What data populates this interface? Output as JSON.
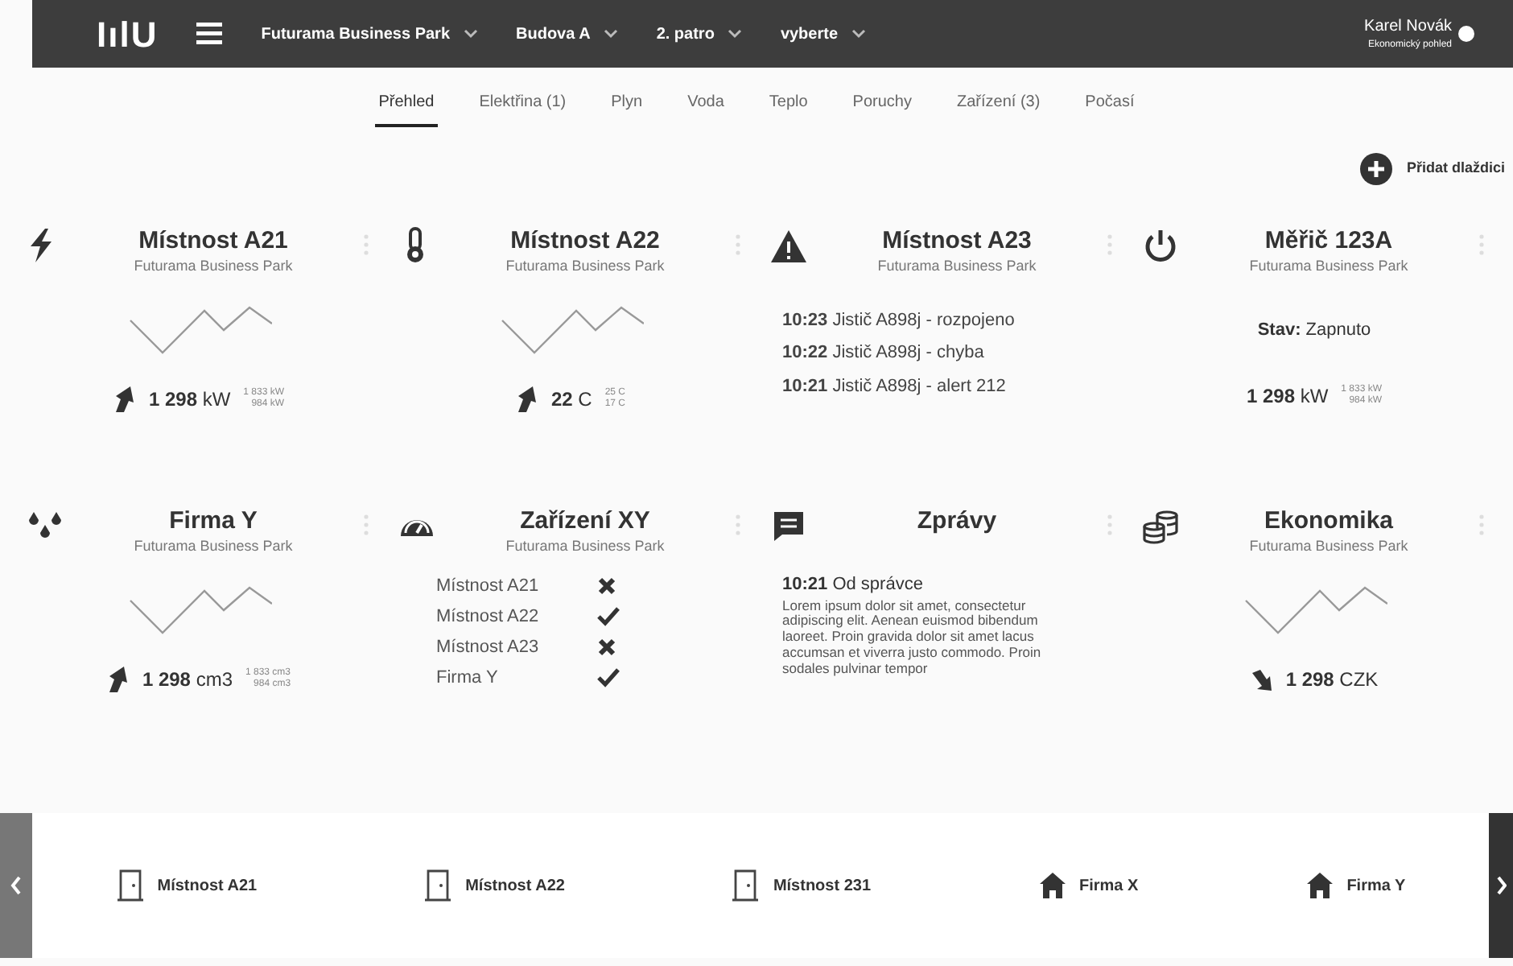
{
  "navbar": {
    "logo": "IılU",
    "breadcrumbs": [
      "Futurama Business Park",
      "Budova A",
      "2. patro",
      "vyberte"
    ],
    "user": {
      "name": "Karel Novák",
      "role": "Ekonomický pohled"
    }
  },
  "tabs": [
    {
      "label": "Přehled",
      "selected": true
    },
    {
      "label": "Elektřina (1)",
      "selected": false
    },
    {
      "label": "Plyn",
      "selected": false
    },
    {
      "label": "Voda",
      "selected": false
    },
    {
      "label": "Teplo",
      "selected": false
    },
    {
      "label": "Poruchy",
      "selected": false
    },
    {
      "label": "Zařízení (3)",
      "selected": false
    },
    {
      "label": "Počasí",
      "selected": false
    }
  ],
  "add_tile": "Přidat dlaždici",
  "tiles": [
    {
      "kind": "metric",
      "title": "Místnost A21",
      "subtitle": "Futurama Business Park",
      "rising": true,
      "value": "1 298",
      "unit": "kW",
      "range": [
        "1 833 kW",
        "984 kW"
      ]
    },
    {
      "kind": "metric",
      "title": "Místnost A22",
      "subtitle": "Futurama Business Park",
      "rising": true,
      "value": "22",
      "unit": "C",
      "range": [
        "25 C",
        "17 C"
      ]
    },
    {
      "kind": "events",
      "title": "Místnost A23",
      "subtitle": "Futurama Business Park",
      "events": [
        {
          "time": "10:23",
          "text": "Jistič A898j - rozpojeno"
        },
        {
          "time": "10:22",
          "text": "Jistič A898j - chyba"
        },
        {
          "time": "10:21",
          "text": "Jistič A898j - alert 212"
        }
      ]
    },
    {
      "kind": "status",
      "title": "Měřič 123A",
      "subtitle": "Futurama Business Park",
      "status_label": "Stav:",
      "status_value": "Zapnuto",
      "value": "1 298",
      "unit": "kW",
      "range": [
        "1 833 kW",
        "984 kW"
      ]
    },
    {
      "kind": "metric",
      "title": "Firma Y",
      "subtitle": "Futurama Business Park",
      "rising": true,
      "value": "1 298",
      "unit": "cm3",
      "range": [
        "1 833 cm3",
        "984 cm3"
      ]
    },
    {
      "kind": "devices",
      "title": "Zařízení XY",
      "subtitle": "Futurama Business Park",
      "devices": [
        {
          "name": "Místnost A21",
          "ok": false
        },
        {
          "name": "Místnost A22",
          "ok": true
        },
        {
          "name": "Místnost A23",
          "ok": false
        },
        {
          "name": "Firma Y",
          "ok": true
        }
      ]
    },
    {
      "kind": "messages",
      "title": "Zprávy",
      "time": "10:21",
      "from": "Od správce",
      "body": "Lorem ipsum dolor sit amet, consectetur adipiscing elit. Aenean euismod bibendum laoreet. Proin gravida dolor sit amet lacus accumsan et viverra justo commodo. Proin sodales pulvinar tempor"
    },
    {
      "kind": "metric",
      "title": "Ekonomika",
      "subtitle": "Futurama Business Park",
      "rising": false,
      "value": "1 298",
      "unit": "CZK"
    }
  ],
  "places": [
    {
      "kind": "room",
      "label": "Místnost A21"
    },
    {
      "kind": "room",
      "label": "Místnost A22"
    },
    {
      "kind": "room",
      "label": "Místnost 231"
    },
    {
      "kind": "building",
      "label": "Firma X"
    },
    {
      "kind": "building",
      "label": "Firma Y"
    }
  ]
}
